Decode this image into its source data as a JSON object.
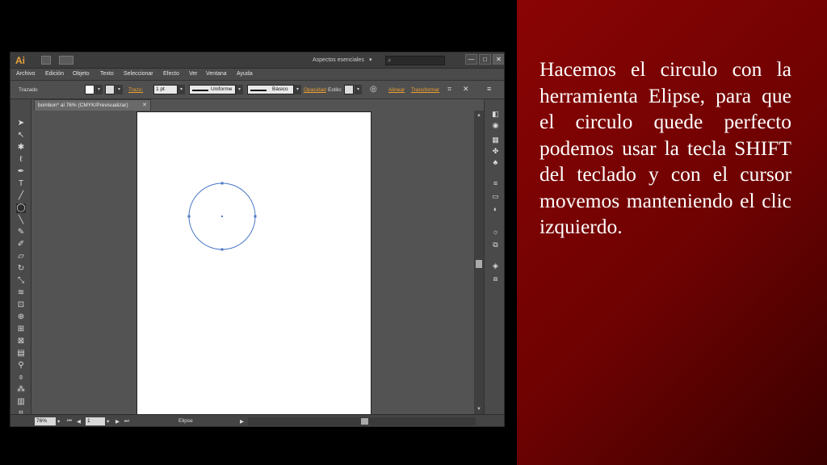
{
  "app": {
    "logo": "Ai",
    "workspace": "Aspectos esenciales",
    "workspace_arrow": "▾",
    "window_controls": [
      "—",
      "□",
      "✕"
    ]
  },
  "menu": [
    "Archivo",
    "Edición",
    "Objeto",
    "Texto",
    "Seleccionar",
    "Efecto",
    "Ver",
    "Ventana",
    "Ayuda"
  ],
  "controlbar": {
    "selection_type": "Trazado",
    "stroke_label": "Trazo:",
    "stroke_weight": "1 pt",
    "profile": "Uniforme",
    "brush": "Básico",
    "opacity_label": "Opacidad",
    "style_label": "Estilo:",
    "align_label": "Alinear",
    "transform_label": "Transformar"
  },
  "document": {
    "tab_title": "bombon* al 76% (CMYK/Previsualizar)",
    "tab_close": "✕"
  },
  "statusbar": {
    "zoom": "76%",
    "artboard": "1",
    "current_tool": "Elipse"
  },
  "colors": {
    "accent_orange": "#f0a030",
    "ellipse_stroke": "#4a78c8",
    "panel_bg": "#8a0404"
  },
  "icons": {
    "tools": [
      "selection-icon",
      "direct-selection-icon",
      "magic-wand-icon",
      "lasso-icon",
      "pen-icon",
      "type-icon",
      "line-icon",
      "ellipse-icon",
      "paintbrush-icon",
      "pencil-icon",
      "blob-brush-icon",
      "eraser-icon",
      "rotate-icon",
      "scale-icon",
      "warp-icon",
      "free-transform-icon",
      "shape-builder-icon",
      "perspective-grid-icon",
      "mesh-icon",
      "gradient-icon",
      "eyedropper-icon",
      "blend-icon",
      "symbol-sprayer-icon",
      "column-graph-icon",
      "artboard-icon"
    ],
    "dock": [
      "color-icon",
      "color-guide-icon",
      "swatches-icon",
      "brushes-icon",
      "symbols-icon",
      "stroke-icon",
      "gradient-panel-icon",
      "transparency-icon",
      "appearance-icon",
      "graphic-styles-icon",
      "layers-icon",
      "artboards-icon"
    ]
  },
  "slide": {
    "text": "Hacemos el circulo con la herramienta Elipse, para que el circulo quede perfecto podemos usar la tecla SHIFT del teclado y con el cursor movemos manteniendo el clic izquierdo."
  }
}
